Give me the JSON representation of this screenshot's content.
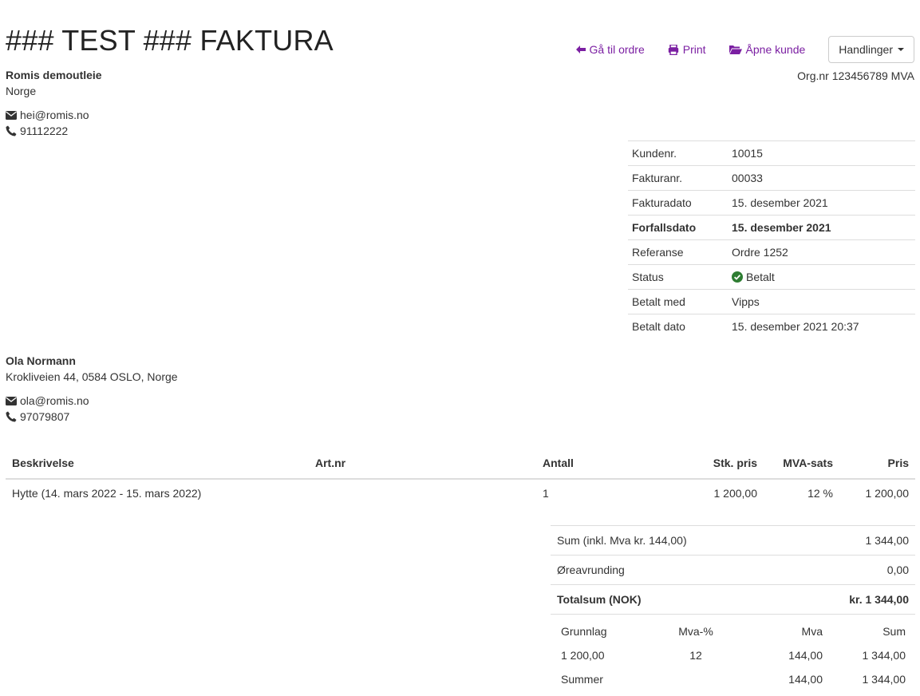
{
  "page": {
    "title": "### TEST ### FAKTURA"
  },
  "actions": {
    "goto_order": "Gå til ordre",
    "print": "Print",
    "open_customer": "Åpne kunde",
    "actions_menu": "Handlinger"
  },
  "seller": {
    "name": "Romis demoutleie",
    "country": "Norge",
    "email": "hei@romis.no",
    "phone": "91112222",
    "orgnr": "Org.nr 123456789 MVA"
  },
  "invoice_info": [
    {
      "label": "Kundenr.",
      "value": "10015"
    },
    {
      "label": "Fakturanr.",
      "value": "00033"
    },
    {
      "label": "Fakturadato",
      "value": "15. desember 2021"
    },
    {
      "label": "Forfallsdato",
      "value": "15. desember 2021"
    },
    {
      "label": "Referanse",
      "value": "Ordre 1252"
    },
    {
      "label": "Status",
      "value": "Betalt"
    },
    {
      "label": "Betalt med",
      "value": "Vipps"
    },
    {
      "label": "Betalt dato",
      "value": "15. desember 2021 20:37"
    }
  ],
  "buyer": {
    "name": "Ola Normann",
    "address": "Krokliveien 44, 0584 OSLO, Norge",
    "email": "ola@romis.no",
    "phone": "97079807"
  },
  "lines": {
    "headers": {
      "description": "Beskrivelse",
      "artnr": "Art.nr",
      "quantity": "Antall",
      "unit_price": "Stk. pris",
      "vat_rate": "MVA-sats",
      "price": "Pris"
    },
    "rows": [
      {
        "description": "Hytte (14. mars 2022 - 15. mars 2022)",
        "artnr": "",
        "quantity": "1",
        "unit_price": "1 200,00",
        "vat_rate": "12 %",
        "price": "1 200,00"
      }
    ]
  },
  "totals": [
    {
      "label": "Sum (inkl. Mva kr. 144,00)",
      "value": "1 344,00"
    },
    {
      "label": "Øreavrunding",
      "value": "0,00"
    },
    {
      "label": "Totalsum (NOK)",
      "value": "kr. 1 344,00"
    }
  ],
  "vat_summary": {
    "headers": {
      "base": "Grunnlag",
      "rate": "Mva-%",
      "vat": "Mva",
      "sum": "Sum"
    },
    "rows": [
      {
        "base": "1 200,00",
        "rate": "12",
        "vat": "144,00",
        "sum": "1 344,00"
      },
      {
        "base": "Summer",
        "rate": "",
        "vat": "144,00",
        "sum": "1 344,00"
      }
    ]
  },
  "colors": {
    "link": "#7b1fa2",
    "status_ok": "#2e7d32",
    "border": "#dddddd"
  }
}
